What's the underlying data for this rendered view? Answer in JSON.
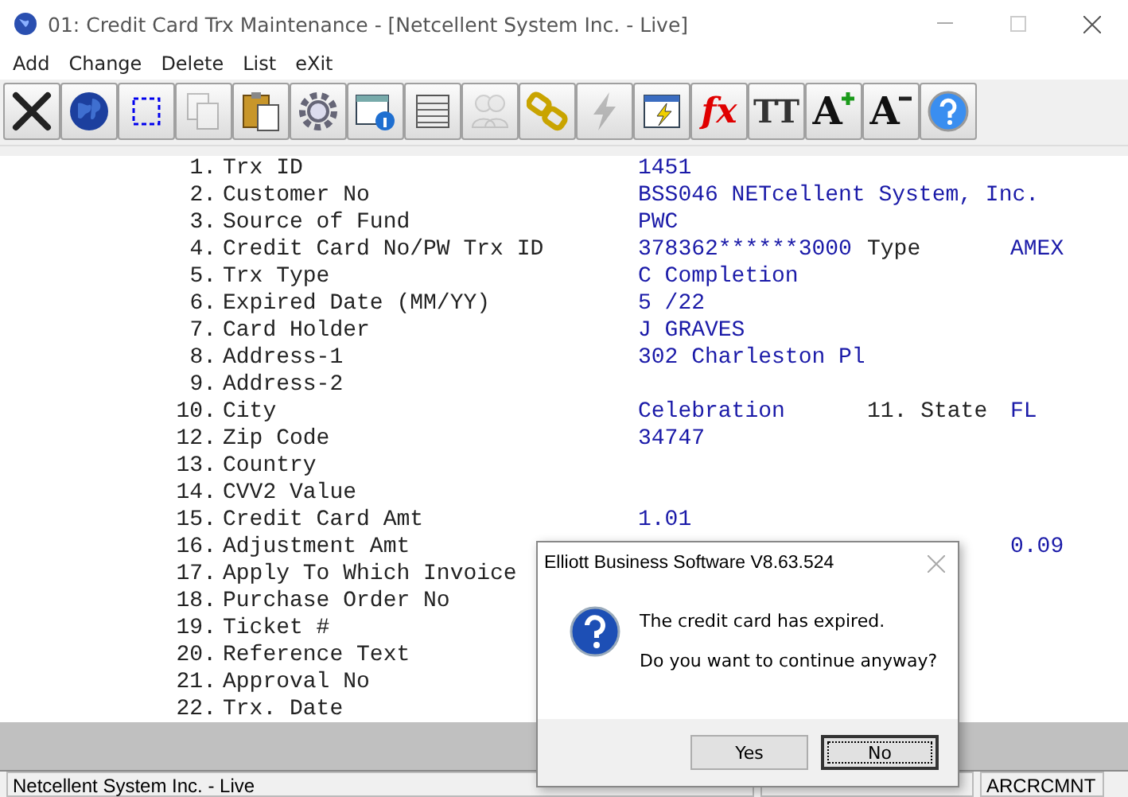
{
  "window": {
    "title": "01: Credit Card Trx Maintenance - [Netcellent System Inc. - Live]"
  },
  "menu": [
    {
      "label": "Add"
    },
    {
      "label": "Change"
    },
    {
      "label": "Delete"
    },
    {
      "label": "List"
    },
    {
      "label": "eXit"
    }
  ],
  "toolbar": [
    {
      "kind": "exit",
      "disabled": false
    },
    {
      "kind": "globe",
      "disabled": false
    },
    {
      "kind": "select",
      "disabled": false
    },
    {
      "kind": "copy",
      "disabled": true
    },
    {
      "kind": "paste",
      "disabled": false
    },
    {
      "kind": "gear",
      "disabled": false
    },
    {
      "kind": "info",
      "disabled": false
    },
    {
      "kind": "list",
      "disabled": false
    },
    {
      "kind": "people",
      "disabled": true
    },
    {
      "kind": "link",
      "disabled": false
    },
    {
      "kind": "lightning",
      "disabled": true
    },
    {
      "kind": "window-lightning",
      "disabled": false
    },
    {
      "kind": "glyph",
      "glyph": "fx",
      "disabled": false
    },
    {
      "kind": "fonts",
      "glyph": "TT",
      "disabled": false
    },
    {
      "kind": "grow",
      "glyph": "A",
      "disabled": false
    },
    {
      "kind": "shrink",
      "glyph": "A",
      "disabled": false
    },
    {
      "kind": "help",
      "disabled": false
    }
  ],
  "fields": [
    {
      "number": "1.",
      "label": "Trx ID",
      "value": "1451"
    },
    {
      "number": "2.",
      "label": "Customer No",
      "value": "BSS046 NETcellent System, Inc."
    },
    {
      "number": "3.",
      "label": "Source of Fund",
      "value": "PWC"
    },
    {
      "number": "4.",
      "label": "Credit Card No/PW Trx ID",
      "value": "378362******3000",
      "extra_label": "Type",
      "extra_value": "AMEX"
    },
    {
      "number": "5.",
      "label": "Trx Type",
      "value": "C Completion"
    },
    {
      "number": "6.",
      "label": "Expired Date (MM/YY)",
      "value": "5 /22"
    },
    {
      "number": "7.",
      "label": "Card Holder",
      "value": "J GRAVES"
    },
    {
      "number": "8.",
      "label": "Address-1",
      "value": "302 Charleston Pl"
    },
    {
      "number": "9.",
      "label": "Address-2"
    },
    {
      "number": "10.",
      "label": "City",
      "value": "Celebration",
      "extra_label": "11. State",
      "extra_value": "FL"
    },
    {
      "number": "12.",
      "label": "Zip Code",
      "value": "34747"
    },
    {
      "number": "13.",
      "label": "Country"
    },
    {
      "number": "14.",
      "label": "CVV2 Value"
    },
    {
      "number": "15.",
      "label": "Credit Card Amt",
      "value": "1.01"
    },
    {
      "number": "16.",
      "label": "Adjustment Amt",
      "extra_value": "0.09"
    },
    {
      "number": "17.",
      "label": "Apply To Which Invoice"
    },
    {
      "number": "18.",
      "label": "Purchase Order No"
    },
    {
      "number": "19.",
      "label": "Ticket #"
    },
    {
      "number": "20.",
      "label": "Reference Text"
    },
    {
      "number": "21.",
      "label": "Approval No"
    },
    {
      "number": "22.",
      "label": "Trx. Date"
    }
  ],
  "status_bar": [
    {
      "text": "Netcellent System Inc. - Live"
    },
    {
      "text": "ARCRCMNT"
    }
  ],
  "dialog": {
    "title": "Elliott Business Software V8.63.524",
    "message": "The credit card has expired.",
    "question": "Do you want to continue anyway?",
    "buttons": [
      {
        "label": "Yes",
        "selected": false
      },
      {
        "label": "No",
        "selected": true
      }
    ]
  }
}
